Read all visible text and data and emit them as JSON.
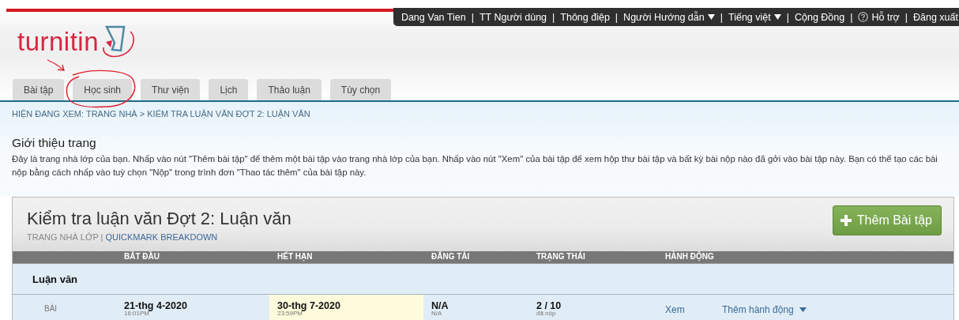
{
  "top_bar": [
    {
      "kind": "link",
      "label": "Dang Van Tien"
    },
    {
      "kind": "separator",
      "label": "|"
    },
    {
      "kind": "link",
      "label": "TT Người dùng"
    },
    {
      "kind": "separator",
      "label": "|"
    },
    {
      "kind": "link",
      "label": "Thông điệp"
    },
    {
      "kind": "separator",
      "label": "|"
    },
    {
      "kind": "dropdown",
      "label": "Người Hướng dẫn"
    },
    {
      "kind": "separator",
      "label": "|"
    },
    {
      "kind": "dropdown",
      "label": "Tiếng việt"
    },
    {
      "kind": "separator",
      "label": "|"
    },
    {
      "kind": "link",
      "label": "Cộng Đồng"
    },
    {
      "kind": "separator",
      "label": "|"
    },
    {
      "kind": "help",
      "label": "Hỗ trợ"
    },
    {
      "kind": "separator",
      "label": "|"
    },
    {
      "kind": "link",
      "label": "Đăng xuất"
    }
  ],
  "logo": {
    "text": "turnitin"
  },
  "tabs": [
    {
      "label": "Bài tập",
      "selected": false
    },
    {
      "label": "Học sinh",
      "selected": false
    },
    {
      "label": "Thư viện",
      "selected": false
    },
    {
      "label": "Lịch",
      "selected": false
    },
    {
      "label": "Thảo luận",
      "selected": false
    },
    {
      "label": "Tùy chọn",
      "selected": false
    }
  ],
  "breadcrumb": "HIỆN ĐANG XEM: TRANG NHÀ > KIỂM TRA LUẬN VĂN ĐỢT 2: LUẬN VĂN",
  "intro": {
    "heading": "Giới thiệu trang",
    "text": "Đây là trang nhà lớp của bạn. Nhấp vào nút \"Thêm bài tập\" để thêm một bài tập vào trang nhà lớp của bạn. Nhấp vào nút \"Xem\" của bài tập để xem hộp thư bài tập và bất kỳ bài nộp nào đã gởi vào bài tập này. Bạn có thể tạo các bài nộp bằng cách nhấp vào tuỳ chọn \"Nộp\" trong trình đơn \"Thao tác thêm\" của bài tập này."
  },
  "class_card": {
    "title": "Kiểm tra luận văn Đợt 2: Luận văn",
    "subtitle": "TRANG NHÀ LỚP |",
    "subtitle_link": "QUICKMARK BREAKDOWN",
    "add_button": "Thêm Bài tập",
    "table": {
      "columns": [
        "BẮT ĐẦU",
        "HẾT HẠN",
        "ĐĂNG TẢI",
        "TRẠNG THÁI",
        "HÀNH ĐỘNG"
      ],
      "group": "Luận văn",
      "rows": [
        {
          "type": "BÀI",
          "start": "21-thg 4-2020",
          "start_time": "16:01PM",
          "due": "30-thg 7-2020",
          "due_time": "23:59PM",
          "post": "N/A",
          "post_time": "N/A",
          "status": "2 / 10",
          "status_note": "đã nộp",
          "view": "Xem",
          "more": "Thêm hành động"
        }
      ]
    }
  }
}
